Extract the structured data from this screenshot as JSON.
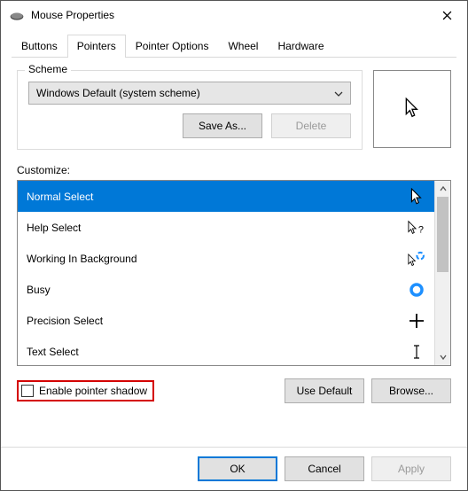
{
  "window": {
    "title": "Mouse Properties"
  },
  "tabs": [
    {
      "label": "Buttons"
    },
    {
      "label": "Pointers"
    },
    {
      "label": "Pointer Options"
    },
    {
      "label": "Wheel"
    },
    {
      "label": "Hardware"
    }
  ],
  "scheme": {
    "legend": "Scheme",
    "selected": "Windows Default (system scheme)",
    "save_as": "Save As...",
    "delete": "Delete"
  },
  "customize": {
    "label": "Customize:",
    "items": [
      {
        "name": "Normal Select",
        "icon": "cursor-arrow-white"
      },
      {
        "name": "Help Select",
        "icon": "cursor-help"
      },
      {
        "name": "Working In Background",
        "icon": "cursor-busy-bg"
      },
      {
        "name": "Busy",
        "icon": "cursor-busy"
      },
      {
        "name": "Precision Select",
        "icon": "cursor-cross"
      },
      {
        "name": "Text Select",
        "icon": "cursor-ibeam"
      }
    ]
  },
  "options": {
    "pointer_shadow": "Enable pointer shadow",
    "use_default": "Use Default",
    "browse": "Browse..."
  },
  "footer": {
    "ok": "OK",
    "cancel": "Cancel",
    "apply": "Apply"
  }
}
